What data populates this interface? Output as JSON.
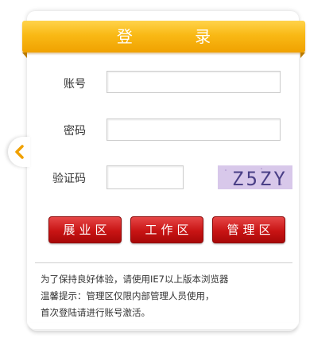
{
  "header": {
    "title": "登 录"
  },
  "form": {
    "account_label": "账号",
    "account_value": "",
    "password_label": "密码",
    "password_value": "",
    "captcha_label": "验证码",
    "captcha_value": "",
    "captcha_image_text": "Z5ZY"
  },
  "buttons": {
    "exhibition": "展业区",
    "work": "工作区",
    "admin": "管理区"
  },
  "notes": {
    "line1": "为了保持良好体验，请使用IE7以上版本浏览器",
    "line2": "温馨提示：管理区仅限内部管理人员使用，",
    "line3": "首次登陆请进行账号激活。"
  },
  "colors": {
    "title_bar": "#f9b915",
    "button_red": "#c81414",
    "collapse_arrow": "#f0a000"
  },
  "icons": {
    "collapse": "chevron-left-icon"
  }
}
